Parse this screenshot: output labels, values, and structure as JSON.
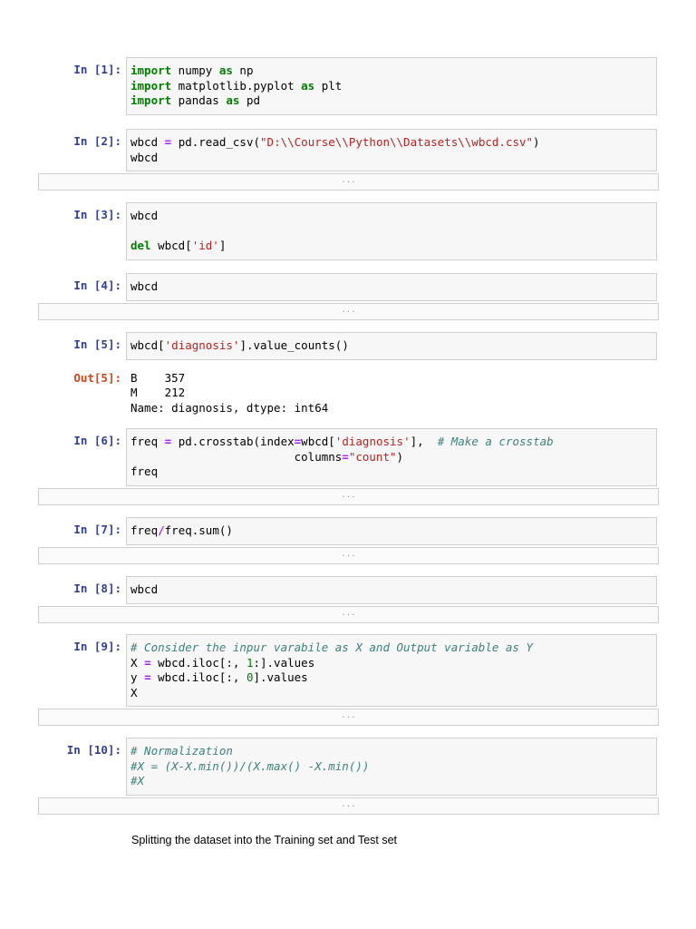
{
  "colors": {
    "prompt_in": "#303F9F",
    "prompt_out": "#D84315",
    "keyword": "#008000",
    "string": "#BA2121",
    "comment": "#408080",
    "operator": "#AA22FF"
  },
  "collapsed_label": "...",
  "cells": [
    {
      "prompt": "In [1]:",
      "lines": [
        [
          [
            "import",
            "k"
          ],
          [
            " numpy ",
            ""
          ],
          [
            "as",
            "k"
          ],
          [
            " np",
            ""
          ]
        ],
        [
          [
            "import",
            "k"
          ],
          [
            " matplotlib.pyplot ",
            ""
          ],
          [
            "as",
            "k"
          ],
          [
            " plt",
            ""
          ]
        ],
        [
          [
            "import",
            "k"
          ],
          [
            " pandas ",
            ""
          ],
          [
            "as",
            "k"
          ],
          [
            " pd",
            ""
          ]
        ]
      ]
    },
    {
      "prompt": "In [2]:",
      "lines": [
        [
          [
            "wbcd ",
            ""
          ],
          [
            "=",
            "o"
          ],
          [
            " pd.read_csv(",
            ""
          ],
          [
            "\"D:\\\\Course\\\\Python\\\\Datasets\\\\wbcd.csv\"",
            "s"
          ],
          [
            ")",
            ""
          ]
        ],
        [
          [
            "wbcd",
            ""
          ]
        ]
      ],
      "collapsed": true
    },
    {
      "prompt": "In [3]:",
      "lines": [
        [
          [
            "wbcd",
            ""
          ]
        ],
        [],
        [
          [
            "del",
            "k"
          ],
          [
            " wbcd[",
            ""
          ],
          [
            "'id'",
            "s"
          ],
          [
            "]",
            ""
          ]
        ]
      ]
    },
    {
      "prompt": "In [4]:",
      "lines": [
        [
          [
            "wbcd",
            ""
          ]
        ]
      ],
      "collapsed": true
    },
    {
      "prompt": "In [5]:",
      "lines": [
        [
          [
            "wbcd[",
            ""
          ],
          [
            "'diagnosis'",
            "s"
          ],
          [
            "].value_counts()",
            ""
          ]
        ]
      ],
      "out_prompt": "Out[5]:",
      "output": [
        "B    357",
        "M    212",
        "Name: diagnosis, dtype: int64"
      ]
    },
    {
      "prompt": "In [6]:",
      "lines": [
        [
          [
            "freq ",
            ""
          ],
          [
            "=",
            "o"
          ],
          [
            " pd.crosstab(index",
            ""
          ],
          [
            "=",
            "o"
          ],
          [
            "wbcd[",
            ""
          ],
          [
            "'diagnosis'",
            "s"
          ],
          [
            "],  ",
            ""
          ],
          [
            "# Make a crosstab",
            "c"
          ]
        ],
        [
          [
            "                        columns",
            ""
          ],
          [
            "=",
            "o"
          ],
          [
            "\"count\"",
            "s"
          ],
          [
            ")",
            ""
          ]
        ],
        [
          [
            "freq",
            ""
          ]
        ]
      ],
      "collapsed": true
    },
    {
      "prompt": "In [7]:",
      "lines": [
        [
          [
            "freq",
            ""
          ],
          [
            "/",
            "o"
          ],
          [
            "freq.sum()",
            ""
          ]
        ]
      ],
      "collapsed": true
    },
    {
      "prompt": "In [8]:",
      "lines": [
        [
          [
            "wbcd",
            ""
          ]
        ]
      ],
      "collapsed": true
    },
    {
      "prompt": "In [9]:",
      "lines": [
        [
          [
            "# Consider the inpur varabile as X and Output variable as Y",
            "c"
          ]
        ],
        [
          [
            "X ",
            ""
          ],
          [
            "=",
            "o"
          ],
          [
            " wbcd.iloc[:, ",
            ""
          ],
          [
            "1",
            "n"
          ],
          [
            ":].values",
            ""
          ]
        ],
        [
          [
            "y ",
            ""
          ],
          [
            "=",
            "o"
          ],
          [
            " wbcd.iloc[:, ",
            ""
          ],
          [
            "0",
            "n"
          ],
          [
            "].values",
            ""
          ]
        ],
        [
          [
            "X",
            ""
          ]
        ]
      ],
      "collapsed": true
    },
    {
      "prompt": "In [10]:",
      "lines": [
        [
          [
            "# Normalization",
            "c"
          ]
        ],
        [
          [
            "#X = (X-X.min())/(X.max() -X.min())",
            "c"
          ]
        ],
        [
          [
            "#X",
            "c"
          ]
        ]
      ],
      "collapsed": true
    }
  ],
  "markdown": "Splitting the dataset into the Training set and Test set"
}
